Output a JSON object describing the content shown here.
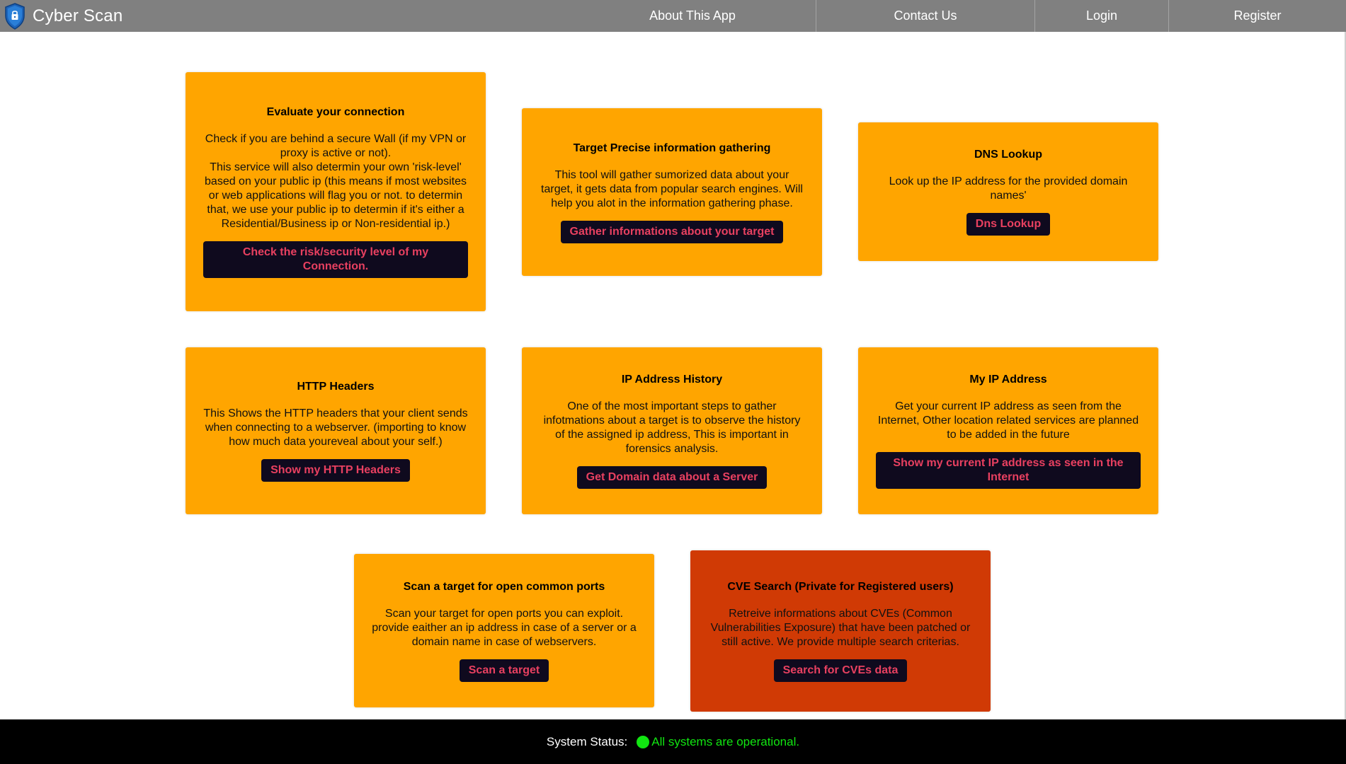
{
  "app": {
    "title": "Cyber Scan"
  },
  "nav": {
    "items": [
      {
        "label": "About This App"
      },
      {
        "label": "Contact Us"
      },
      {
        "label": "Login"
      },
      {
        "label": "Register"
      }
    ]
  },
  "cards": [
    {
      "title": "Evaluate your connection",
      "description": "Check if you are behind a secure Wall (if my VPN or proxy is active or not).\nThis service will also determin your own 'risk-level' based on your public ip (this means if most websites or web applications will flag you or not. to determin that, we use your public ip to determin if it's either a Residential/Business ip or Non-residential ip.)",
      "button": "Check the risk/security level of my Connection."
    },
    {
      "title": "Target Precise information gathering",
      "description": "This tool will gather sumorized data about your target, it gets data from popular search engines. Will help you alot in the information gathering phase.",
      "button": "Gather informations about your target"
    },
    {
      "title": "DNS Lookup",
      "description": "Look up the IP address for the provided domain names'",
      "button": "Dns Lookup"
    },
    {
      "title": "HTTP Headers",
      "description": "This Shows the HTTP headers that your client sends when connecting to a webserver. (importing to know how much data youreveal about your self.)",
      "button": "Show my HTTP Headers"
    },
    {
      "title": "IP Address History",
      "description": "One of the most important steps to gather infotmations about a target is to observe the history of the assigned ip address, This is important in forensics analysis.",
      "button": "Get Domain data about a Server"
    },
    {
      "title": "My IP Address",
      "description": "Get your current IP address as seen from the Internet, Other location related services are planned to be added in the future",
      "button": "Show my current IP address as seen in the Internet"
    },
    {
      "title": "Scan a target for open common ports",
      "description": "Scan your target for open ports you can exploit. provide eaither an ip address in case of a server or a domain name in case of webservers.",
      "button": "Scan a target"
    },
    {
      "title": "CVE Search (Private for Registered users)",
      "description": "Retreive informations about CVEs (Common Vulnerabilities Exposure) that have been patched or still active. We provide multiple search criterias.",
      "button": "Search for CVEs data"
    }
  ],
  "footer": {
    "label": "System Status:",
    "status": "All systems are operational."
  },
  "colors": {
    "navbar": "#808080",
    "card": "#FFA500",
    "card_restricted": "#D03A05",
    "button_bg": "#0F0A1E",
    "button_text": "#E84060",
    "footer_bg": "#000000",
    "status_ok": "#11E511"
  },
  "icons": {
    "logo": "shield-lock-icon",
    "status": "status-dot-icon"
  }
}
